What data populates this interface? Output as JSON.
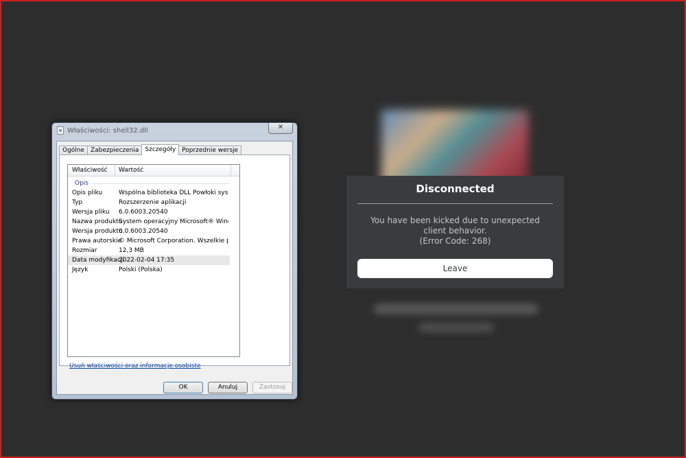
{
  "properties_dialog": {
    "title": "Właściwości: shell32.dll",
    "close_label": "✕",
    "tabs": [
      {
        "label": "Ogólne"
      },
      {
        "label": "Zabezpieczenia"
      },
      {
        "label": "Szczegóły"
      },
      {
        "label": "Poprzednie wersje"
      }
    ],
    "active_tab": "Szczegóły",
    "columns": {
      "property": "Właściwość",
      "value": "Wartość"
    },
    "group": "Opis",
    "rows": [
      {
        "key": "Opis pliku",
        "value": "Wspólna biblioteka DLL Powłoki system..."
      },
      {
        "key": "Typ",
        "value": "Rozszerzenie aplikacji"
      },
      {
        "key": "Wersja pliku",
        "value": "6.0.6003.20540"
      },
      {
        "key": "Nazwa produktu",
        "value": "System operacyjny Microsoft® Windows®"
      },
      {
        "key": "Wersja produktu",
        "value": "6.0.6003.20540"
      },
      {
        "key": "Prawa autorskie",
        "value": "© Microsoft Corporation. Wszelkie praw..."
      },
      {
        "key": "Rozmiar",
        "value": "12,3 MB"
      },
      {
        "key": "Data modyfikacji",
        "value": "2022-02-04 17:35"
      },
      {
        "key": "Język",
        "value": "Polski (Polska)"
      }
    ],
    "selected_row": "Data modyfikacji",
    "remove_link": "Usuń właściwości oraz informacje osobiste",
    "buttons": {
      "ok": "OK",
      "cancel": "Anuluj",
      "apply": "Zastosuj"
    }
  },
  "disconnect_dialog": {
    "title": "Disconnected",
    "message": "You have been kicked due to unexpected client behavior.",
    "error_code": "(Error Code: 268)",
    "leave_label": "Leave"
  },
  "colors": {
    "background": "#2d2d2d",
    "frame_border": "#d21f1f",
    "panel": "#393b3d",
    "link": "#0645ad"
  }
}
